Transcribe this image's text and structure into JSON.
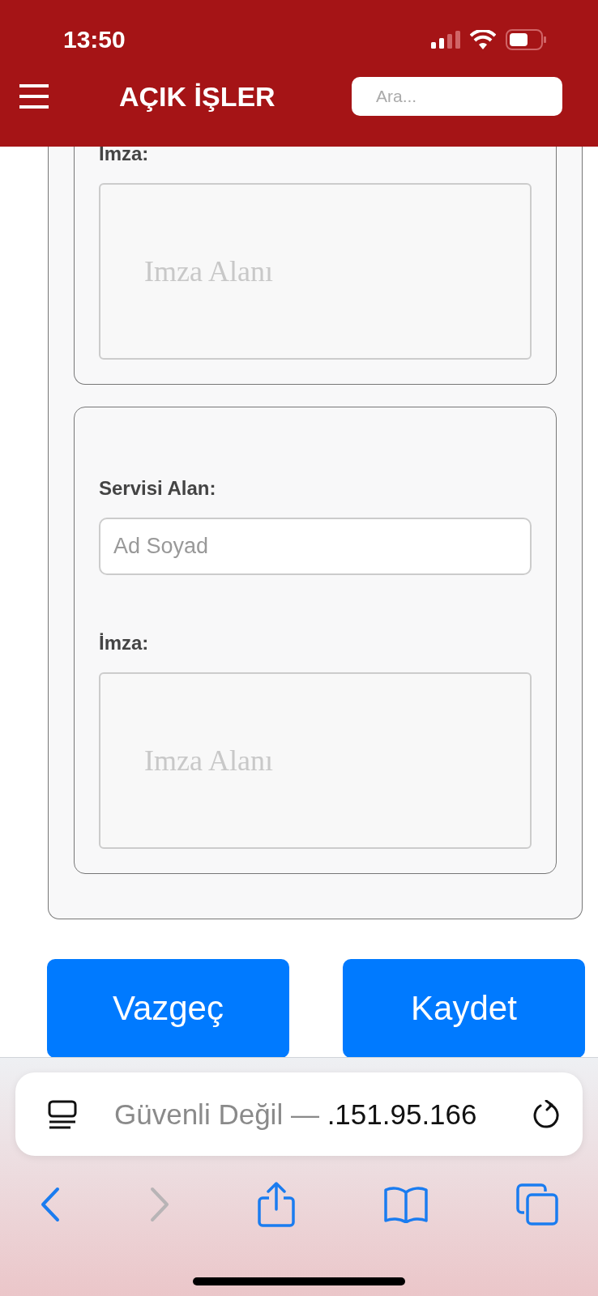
{
  "status_bar": {
    "time": "13:50"
  },
  "header": {
    "title": "AÇIK İŞLER",
    "search": {
      "placeholder": "Ara..."
    }
  },
  "sections": [
    {
      "fields": [
        {
          "kind": "signature",
          "label": "Imza:",
          "placeholder": "Imza Alanı"
        }
      ]
    },
    {
      "fields": [
        {
          "kind": "text",
          "label": "Servisi Alan:",
          "placeholder": "Ad Soyad"
        },
        {
          "kind": "signature",
          "label": "İmza:",
          "placeholder": "Imza Alanı"
        }
      ]
    }
  ],
  "buttons": [
    "Vazgeç",
    "Kaydet"
  ],
  "browser": {
    "security_label": "Güvenli Değil —",
    "address": ".151.95.166",
    "toolbar": [
      {
        "kind": "back",
        "disabled": false
      },
      {
        "kind": "forward",
        "disabled": true
      },
      {
        "kind": "share",
        "disabled": false
      },
      {
        "kind": "bookmarks",
        "disabled": false
      },
      {
        "kind": "tabs",
        "disabled": false
      }
    ]
  }
}
